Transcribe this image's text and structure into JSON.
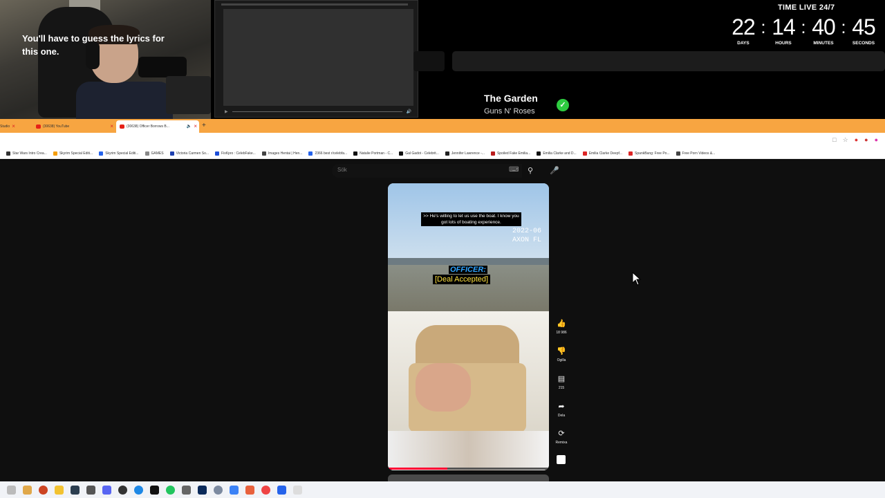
{
  "lyrics_overlay": {
    "text": "You'll have to guess the lyrics for this one."
  },
  "timer": {
    "label": "TIME LIVE 24/7",
    "units": [
      {
        "value": "22",
        "unit": "DAYS"
      },
      {
        "value": "14",
        "unit": "HOURS"
      },
      {
        "value": "40",
        "unit": "MINUTES"
      },
      {
        "value": "45",
        "unit": "SECONDS"
      }
    ]
  },
  "song": {
    "title": "The Garden",
    "artist": "Guns N' Roses",
    "check_icon": "check-circle-icon",
    "check_color": "#2ecc40"
  },
  "browser": {
    "accent_color": "#f7a541",
    "tabs": [
      {
        "label": "Studio"
      },
      {
        "label": "(30638) YouTube"
      },
      {
        "label": "(30638) Officer Borrows B..."
      }
    ],
    "new_tab": "+",
    "bookmarks": [
      "Star Wars Intro Crea...",
      "Skyrim Special Editi...",
      "Skyrim Special Editi...",
      "GAMES",
      "Victoria Carmen So...",
      "FixKpro : CelebFake...",
      "Images Hentai | Hen...",
      "2366 best r/celebfa...",
      "Natalie Portman - C...",
      "Gal Gadot - Celebrit...",
      "Jennifer Lawrence -...",
      "Spoiled Fake Emilia...",
      "Emilia Clarke and D...",
      "Emilia Clarke Deepf...",
      "SpankBang: Free Po...",
      "Free Porn Videos &..."
    ]
  },
  "youtube": {
    "search_placeholder": "Sök",
    "video": {
      "caption_line": ">> He's willing to let us use the boat. I know you got lots of boating experience.",
      "stamp_line1": "2022-06",
      "stamp_line2": "AXON FL",
      "speaker": "OFFICER:",
      "deal_text": "[Deal Accepted]",
      "progress": 0.37
    },
    "actions": [
      {
        "icon": "thumbs-up-icon",
        "label": "18 986"
      },
      {
        "icon": "thumbs-down-icon",
        "label": "Ogilla"
      },
      {
        "icon": "comment-icon",
        "label": "215"
      },
      {
        "icon": "share-icon",
        "label": "Dela"
      },
      {
        "icon": "remix-icon",
        "label": "Remixa"
      }
    ]
  }
}
